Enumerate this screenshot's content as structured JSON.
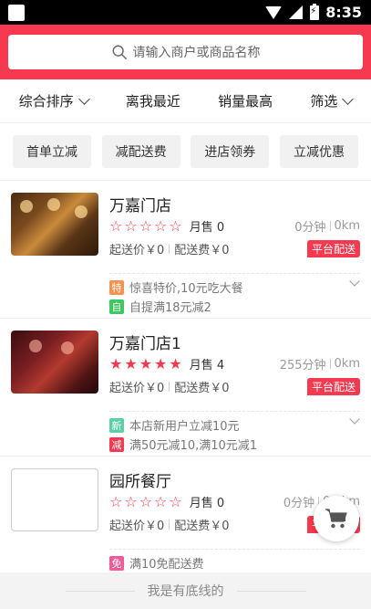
{
  "status_bar": {
    "time": "8:35"
  },
  "search": {
    "placeholder": "请输入商户或商品名称"
  },
  "sort_options": [
    {
      "label": "综合排序",
      "has_chevron": true
    },
    {
      "label": "离我最近",
      "has_chevron": false
    },
    {
      "label": "销量最高",
      "has_chevron": false
    },
    {
      "label": "筛选",
      "has_chevron": true
    }
  ],
  "filter_chips": [
    "首单立减",
    "减配送费",
    "进店领券",
    "立减优惠"
  ],
  "shops": [
    {
      "name": "万嘉门店",
      "rating": 0,
      "monthly_sales": "月售 0",
      "time": "0分钟",
      "distance": "0km",
      "min_order": "起送价￥0",
      "delivery_fee": "配送费￥0",
      "delivery_badge": "平台配送",
      "promos": [
        {
          "badge": "特",
          "color": "#f5924e",
          "text": "惊喜特价,10元吃大餐"
        },
        {
          "badge": "自",
          "color": "#3cc75f",
          "text": "自提满18元减2"
        }
      ]
    },
    {
      "name": "万嘉门店1",
      "rating": 5,
      "monthly_sales": "月售 4",
      "time": "255分钟",
      "distance": "0km",
      "min_order": "起送价￥0",
      "delivery_fee": "配送费￥0",
      "delivery_badge": "平台配送",
      "promos": [
        {
          "badge": "新",
          "color": "#5ccfa6",
          "text": "本店新用户立减10元"
        },
        {
          "badge": "减",
          "color": "#f6394f",
          "text": "满50元减10,满10元减1"
        }
      ]
    },
    {
      "name": "园所餐厅",
      "rating": 0,
      "monthly_sales": "月售 0",
      "time": "0分钟",
      "distance": "0.0km",
      "min_order": "起送价￥0",
      "delivery_fee": "配送费￥0",
      "delivery_badge": "平台配送",
      "promos": [
        {
          "badge": "免",
          "color": "#f15a9a",
          "text": "满10免配送费"
        }
      ]
    }
  ],
  "footer_text": "我是有底线的",
  "colors": {
    "brand": "#f6394f"
  },
  "icons": {
    "search": "search-icon",
    "cart": "cart-icon"
  }
}
